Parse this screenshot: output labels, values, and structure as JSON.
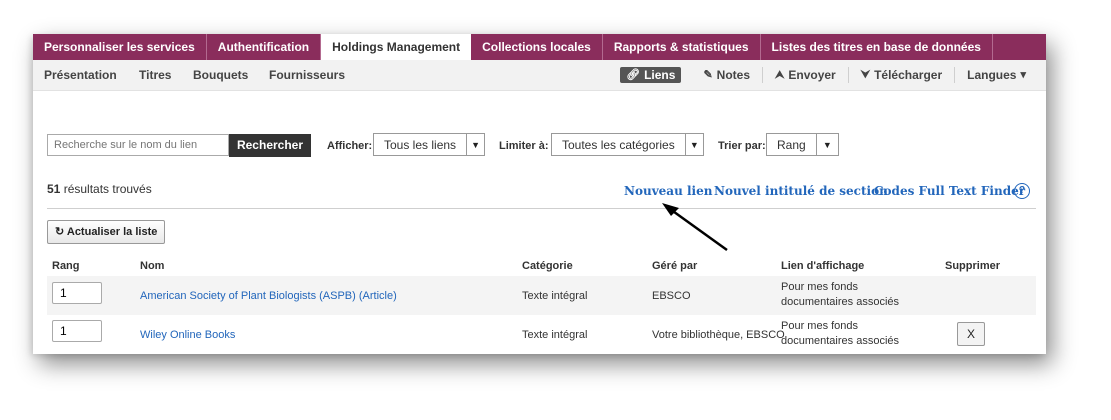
{
  "tabs": [
    "Personnaliser les services",
    "Authentification",
    "Holdings Management",
    "Collections locales",
    "Rapports & statistiques",
    "Listes des titres en base de données"
  ],
  "subnav": {
    "left": [
      "Présentation",
      "Titres",
      "Bouquets",
      "Fournisseurs"
    ],
    "liens": "Liens",
    "notes": "Notes",
    "envoyer": "Envoyer",
    "telecharger": "Télécharger",
    "langues": "Langues"
  },
  "search": {
    "placeholder": "Recherche sur le nom du lien",
    "button": "Rechercher"
  },
  "filters": {
    "afficher_label": "Afficher:",
    "afficher_value": "Tous les liens",
    "limiter_label": "Limiter à:",
    "limiter_value": "Toutes les catégories",
    "trier_label": "Trier par:",
    "trier_value": "Rang"
  },
  "results": {
    "count": "51",
    "text": " résultats trouvés"
  },
  "links": {
    "nouveau": "Nouveau lien",
    "section": "Nouvel intitulé de section",
    "codes": "Codes Full Text Finder",
    "help": "?"
  },
  "refresh": "Actualiser la liste",
  "table": {
    "headers": [
      "Rang",
      "Nom",
      "Catégorie",
      "Géré par",
      "Lien d'affichage",
      "Supprimer"
    ],
    "rows": [
      {
        "rang": "1",
        "nom": "American Society of Plant Biologists (ASPB) (Article)",
        "categorie": "Texte intégral",
        "gere": "EBSCO",
        "lien": "Pour mes fonds documentaires associés",
        "supprimer": ""
      },
      {
        "rang": "1",
        "nom": "Wiley Online Books",
        "categorie": "Texte intégral",
        "gere": "Votre bibliothèque, EBSCO",
        "lien": "Pour mes fonds documentaires associés",
        "supprimer": "X"
      }
    ]
  },
  "colors": {
    "tab_bg": "#8a2d5c",
    "link": "#2266bb"
  }
}
